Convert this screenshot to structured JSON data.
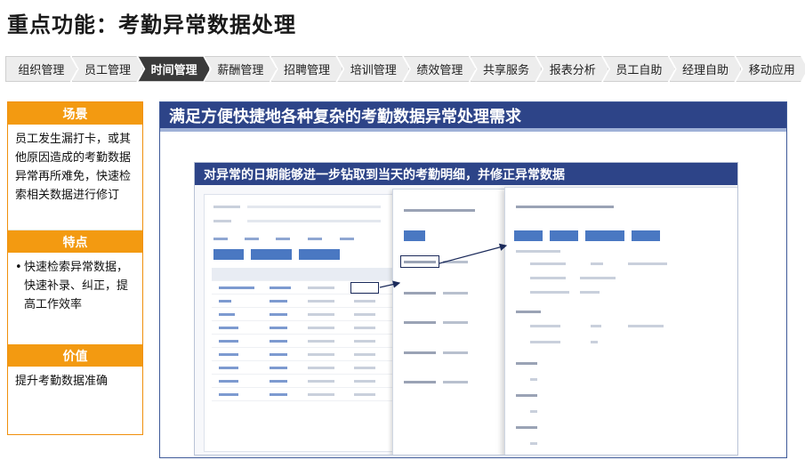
{
  "page": {
    "title": "重点功能：考勤异常数据处理"
  },
  "nav": {
    "tabs": [
      {
        "label": "组织管理",
        "active": false
      },
      {
        "label": "员工管理",
        "active": false
      },
      {
        "label": "时间管理",
        "active": true
      },
      {
        "label": "薪酬管理",
        "active": false
      },
      {
        "label": "招聘管理",
        "active": false
      },
      {
        "label": "培训管理",
        "active": false
      },
      {
        "label": "绩效管理",
        "active": false
      },
      {
        "label": "共享服务",
        "active": false
      },
      {
        "label": "报表分析",
        "active": false
      },
      {
        "label": "员工自助",
        "active": false
      },
      {
        "label": "经理自助",
        "active": false
      },
      {
        "label": "移动应用",
        "active": false
      }
    ]
  },
  "left": {
    "scene": {
      "heading": "场景",
      "text": "员工发生漏打卡，或其他原因造成的考勤数据异常再所难免，快速检索相关数据进行修订"
    },
    "features": {
      "heading": "特点",
      "items": [
        "快速检索异常数据，快速补录、纠正，提高工作效率"
      ]
    },
    "value": {
      "heading": "价值",
      "text": "提升考勤数据准确"
    }
  },
  "right": {
    "banner": "满足方便快捷地各种复杂的考勤数据异常处理需求",
    "inner_banner": "对异常的日期能够进一步钻取到当天的考勤明细，并修正异常数据"
  },
  "colors": {
    "accent_orange": "#f39a11",
    "banner_navy": "#2d4488",
    "active_tab": "#3a3a3a"
  }
}
